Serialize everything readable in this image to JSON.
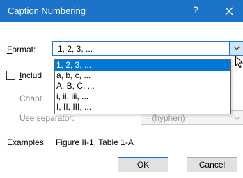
{
  "window": {
    "title": "Caption Numbering",
    "help_label": "?"
  },
  "format": {
    "label_ul": "F",
    "label_rest": "ormat:",
    "value": "1, 2, 3, ...",
    "options": [
      "1, 2, 3, ...",
      "a, b, c, ...",
      "A, B, C, ...",
      "i, ii, iii, ...",
      "I, II, III, ..."
    ],
    "selected_index": 0
  },
  "include": {
    "label_ul": "I",
    "label_rest": "nclud",
    "checked": false
  },
  "chapter": {
    "label": "Chapt"
  },
  "separator": {
    "label": "Use separator:",
    "value": "-    (hyphen)"
  },
  "examples": {
    "label": "Examples:",
    "value": "Figure II-1, Table 1-A"
  },
  "buttons": {
    "ok": "OK",
    "cancel": "Cancel"
  }
}
